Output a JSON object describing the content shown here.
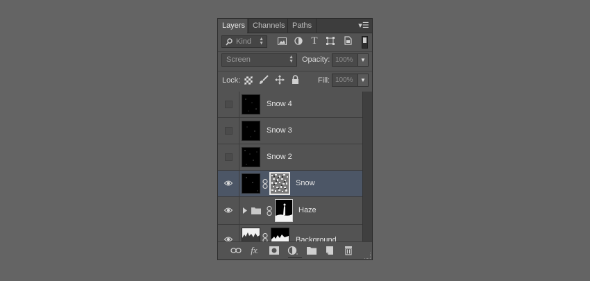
{
  "tabs": [
    {
      "label": "Layers",
      "active": true
    },
    {
      "label": "Channels",
      "active": false
    },
    {
      "label": "Paths",
      "active": false
    }
  ],
  "filter": {
    "kind_label": "Kind",
    "icons": [
      "image-filter-icon",
      "adjustment-filter-icon",
      "type-filter-icon",
      "shape-filter-icon",
      "smart-object-filter-icon"
    ]
  },
  "blend": {
    "mode": "Screen",
    "opacity_label": "Opacity:",
    "opacity_value": "100%"
  },
  "lock": {
    "label": "Lock:",
    "fill_label": "Fill:",
    "fill_value": "100%",
    "icons": [
      "lock-transparent-pixels-icon",
      "lock-image-pixels-icon",
      "lock-position-icon",
      "lock-all-icon"
    ]
  },
  "layers": [
    {
      "name": "Snow 4",
      "visible": false,
      "selected": false
    },
    {
      "name": "Snow 3",
      "visible": false,
      "selected": false
    },
    {
      "name": "Snow 2",
      "visible": false,
      "selected": false
    },
    {
      "name": "Snow",
      "visible": true,
      "selected": true
    },
    {
      "name": "Haze",
      "visible": true,
      "selected": false,
      "group": true
    },
    {
      "name": "Background",
      "visible": true,
      "selected": false
    }
  ],
  "bottom_icons": [
    "link-layers-icon",
    "fx-icon",
    "add-mask-icon",
    "adjustment-layer-icon",
    "new-group-icon",
    "new-layer-icon",
    "delete-icon"
  ],
  "colors": {
    "panel": "#535353",
    "selected_row": "#4c5666",
    "background": "#646464"
  }
}
